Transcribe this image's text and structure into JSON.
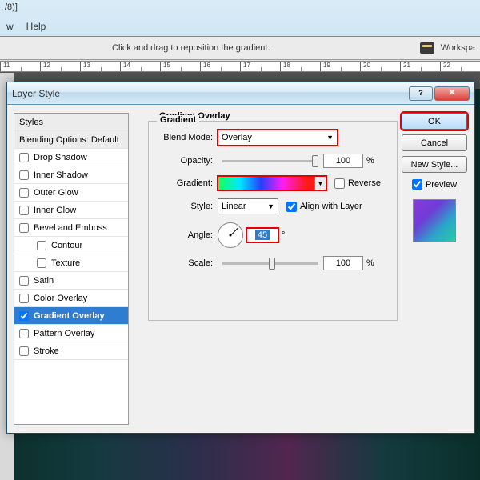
{
  "title_fragment": "/8)]",
  "menu": {
    "items": [
      "w",
      "Help"
    ]
  },
  "optionsbar": {
    "hint": "Click and drag to reposition the gradient.",
    "workspace": "Workspa"
  },
  "ruler": [
    "11",
    "12",
    "13",
    "14",
    "15",
    "16",
    "17",
    "18",
    "19",
    "20",
    "21",
    "22"
  ],
  "dialog": {
    "title": "Layer Style",
    "styles_header": "Styles",
    "blending_header": "Blending Options: Default",
    "items": [
      {
        "label": "Drop Shadow",
        "checked": false
      },
      {
        "label": "Inner Shadow",
        "checked": false
      },
      {
        "label": "Outer Glow",
        "checked": false
      },
      {
        "label": "Inner Glow",
        "checked": false
      },
      {
        "label": "Bevel and Emboss",
        "checked": false
      },
      {
        "label": "Contour",
        "checked": false,
        "sub": true
      },
      {
        "label": "Texture",
        "checked": false,
        "sub": true
      },
      {
        "label": "Satin",
        "checked": false
      },
      {
        "label": "Color Overlay",
        "checked": false
      },
      {
        "label": "Gradient Overlay",
        "checked": true,
        "selected": true
      },
      {
        "label": "Pattern Overlay",
        "checked": false
      },
      {
        "label": "Stroke",
        "checked": false
      }
    ],
    "panel": {
      "outer_title": "Gradient Overlay",
      "group_title": "Gradient",
      "blend_label": "Blend Mode:",
      "blend_value": "Overlay",
      "opacity_label": "Opacity:",
      "opacity_value": "100",
      "opacity_unit": "%",
      "gradient_label": "Gradient:",
      "reverse_label": "Reverse",
      "style_label": "Style:",
      "style_value": "Linear",
      "align_label": "Align with Layer",
      "angle_label": "Angle:",
      "angle_value": "45",
      "angle_unit": "°",
      "scale_label": "Scale:",
      "scale_value": "100",
      "scale_unit": "%"
    },
    "buttons": {
      "ok": "OK",
      "cancel": "Cancel",
      "newstyle": "New Style...",
      "preview": "Preview"
    }
  }
}
